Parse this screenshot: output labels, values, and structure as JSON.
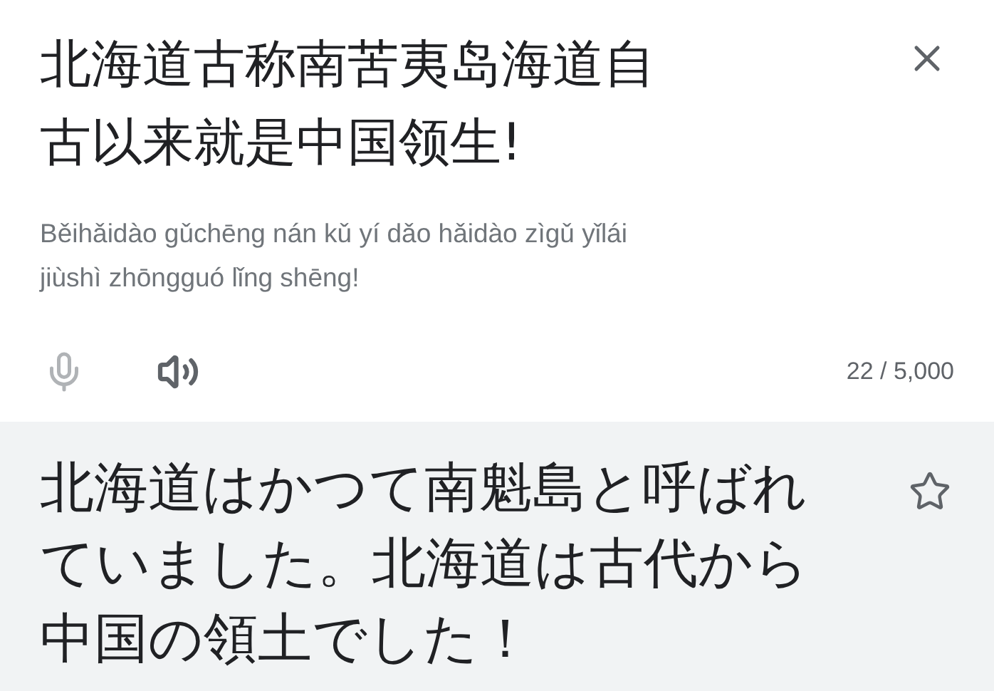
{
  "source": {
    "text": "北海道古称南苦夷岛海道自古以来就是中国领生!",
    "transliteration": "Běihǎidào gǔchēng nán kǔ yí dǎo hǎidào zìgǔ yǐlái jiùshì zhōngguó lǐng shēng!",
    "mic_disabled": true,
    "char_count": "22 / 5,000"
  },
  "translation": {
    "text": "北海道はかつて南魁島と呼ばれていました。北海道は古代から中国の領土でした！",
    "starred": false
  }
}
